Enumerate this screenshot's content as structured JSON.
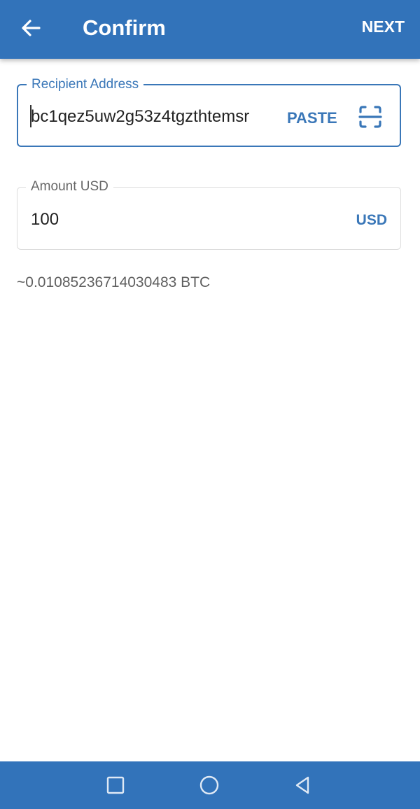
{
  "app_bar": {
    "title": "Confirm",
    "next_label": "NEXT",
    "back_icon": "arrow-left-icon",
    "color": "#3273ba"
  },
  "recipient": {
    "label": "Recipient Address",
    "value": "bc1qez5uw2g53z4tgzthtemsr",
    "paste_label": "PASTE",
    "scan_icon": "scan-qr-icon"
  },
  "amount": {
    "label": "Amount USD",
    "value": "100",
    "currency_label": "USD"
  },
  "conversion_text": "~0.01085236714030483 BTC",
  "nav_bar": {
    "icons": [
      "recents-square-icon",
      "home-circle-icon",
      "back-triangle-icon"
    ]
  },
  "colors": {
    "accent": "#3a77b8",
    "bar": "#3273ba"
  }
}
